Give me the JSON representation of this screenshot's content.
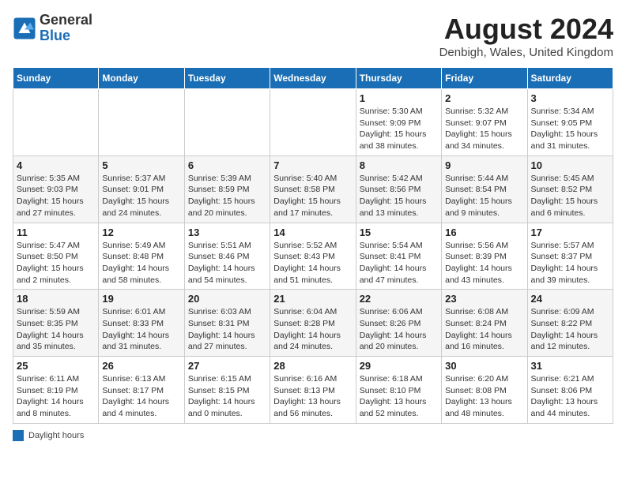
{
  "header": {
    "logo_general": "General",
    "logo_blue": "Blue",
    "month_year": "August 2024",
    "location": "Denbigh, Wales, United Kingdom"
  },
  "weekdays": [
    "Sunday",
    "Monday",
    "Tuesday",
    "Wednesday",
    "Thursday",
    "Friday",
    "Saturday"
  ],
  "weeks": [
    [
      {
        "day": "",
        "info": ""
      },
      {
        "day": "",
        "info": ""
      },
      {
        "day": "",
        "info": ""
      },
      {
        "day": "",
        "info": ""
      },
      {
        "day": "1",
        "info": "Sunrise: 5:30 AM\nSunset: 9:09 PM\nDaylight: 15 hours and 38 minutes."
      },
      {
        "day": "2",
        "info": "Sunrise: 5:32 AM\nSunset: 9:07 PM\nDaylight: 15 hours and 34 minutes."
      },
      {
        "day": "3",
        "info": "Sunrise: 5:34 AM\nSunset: 9:05 PM\nDaylight: 15 hours and 31 minutes."
      }
    ],
    [
      {
        "day": "4",
        "info": "Sunrise: 5:35 AM\nSunset: 9:03 PM\nDaylight: 15 hours and 27 minutes."
      },
      {
        "day": "5",
        "info": "Sunrise: 5:37 AM\nSunset: 9:01 PM\nDaylight: 15 hours and 24 minutes."
      },
      {
        "day": "6",
        "info": "Sunrise: 5:39 AM\nSunset: 8:59 PM\nDaylight: 15 hours and 20 minutes."
      },
      {
        "day": "7",
        "info": "Sunrise: 5:40 AM\nSunset: 8:58 PM\nDaylight: 15 hours and 17 minutes."
      },
      {
        "day": "8",
        "info": "Sunrise: 5:42 AM\nSunset: 8:56 PM\nDaylight: 15 hours and 13 minutes."
      },
      {
        "day": "9",
        "info": "Sunrise: 5:44 AM\nSunset: 8:54 PM\nDaylight: 15 hours and 9 minutes."
      },
      {
        "day": "10",
        "info": "Sunrise: 5:45 AM\nSunset: 8:52 PM\nDaylight: 15 hours and 6 minutes."
      }
    ],
    [
      {
        "day": "11",
        "info": "Sunrise: 5:47 AM\nSunset: 8:50 PM\nDaylight: 15 hours and 2 minutes."
      },
      {
        "day": "12",
        "info": "Sunrise: 5:49 AM\nSunset: 8:48 PM\nDaylight: 14 hours and 58 minutes."
      },
      {
        "day": "13",
        "info": "Sunrise: 5:51 AM\nSunset: 8:46 PM\nDaylight: 14 hours and 54 minutes."
      },
      {
        "day": "14",
        "info": "Sunrise: 5:52 AM\nSunset: 8:43 PM\nDaylight: 14 hours and 51 minutes."
      },
      {
        "day": "15",
        "info": "Sunrise: 5:54 AM\nSunset: 8:41 PM\nDaylight: 14 hours and 47 minutes."
      },
      {
        "day": "16",
        "info": "Sunrise: 5:56 AM\nSunset: 8:39 PM\nDaylight: 14 hours and 43 minutes."
      },
      {
        "day": "17",
        "info": "Sunrise: 5:57 AM\nSunset: 8:37 PM\nDaylight: 14 hours and 39 minutes."
      }
    ],
    [
      {
        "day": "18",
        "info": "Sunrise: 5:59 AM\nSunset: 8:35 PM\nDaylight: 14 hours and 35 minutes."
      },
      {
        "day": "19",
        "info": "Sunrise: 6:01 AM\nSunset: 8:33 PM\nDaylight: 14 hours and 31 minutes."
      },
      {
        "day": "20",
        "info": "Sunrise: 6:03 AM\nSunset: 8:31 PM\nDaylight: 14 hours and 27 minutes."
      },
      {
        "day": "21",
        "info": "Sunrise: 6:04 AM\nSunset: 8:28 PM\nDaylight: 14 hours and 24 minutes."
      },
      {
        "day": "22",
        "info": "Sunrise: 6:06 AM\nSunset: 8:26 PM\nDaylight: 14 hours and 20 minutes."
      },
      {
        "day": "23",
        "info": "Sunrise: 6:08 AM\nSunset: 8:24 PM\nDaylight: 14 hours and 16 minutes."
      },
      {
        "day": "24",
        "info": "Sunrise: 6:09 AM\nSunset: 8:22 PM\nDaylight: 14 hours and 12 minutes."
      }
    ],
    [
      {
        "day": "25",
        "info": "Sunrise: 6:11 AM\nSunset: 8:19 PM\nDaylight: 14 hours and 8 minutes."
      },
      {
        "day": "26",
        "info": "Sunrise: 6:13 AM\nSunset: 8:17 PM\nDaylight: 14 hours and 4 minutes."
      },
      {
        "day": "27",
        "info": "Sunrise: 6:15 AM\nSunset: 8:15 PM\nDaylight: 14 hours and 0 minutes."
      },
      {
        "day": "28",
        "info": "Sunrise: 6:16 AM\nSunset: 8:13 PM\nDaylight: 13 hours and 56 minutes."
      },
      {
        "day": "29",
        "info": "Sunrise: 6:18 AM\nSunset: 8:10 PM\nDaylight: 13 hours and 52 minutes."
      },
      {
        "day": "30",
        "info": "Sunrise: 6:20 AM\nSunset: 8:08 PM\nDaylight: 13 hours and 48 minutes."
      },
      {
        "day": "31",
        "info": "Sunrise: 6:21 AM\nSunset: 8:06 PM\nDaylight: 13 hours and 44 minutes."
      }
    ]
  ],
  "legend": {
    "label": "Daylight hours"
  }
}
